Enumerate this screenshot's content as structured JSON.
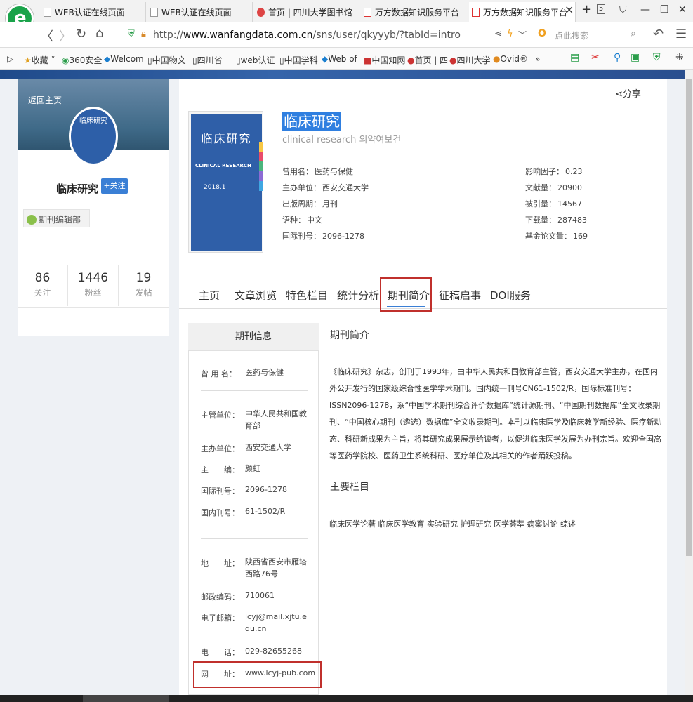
{
  "browser": {
    "tabs": [
      {
        "label": "WEB认证在线页面"
      },
      {
        "label": "WEB认证在线页面"
      },
      {
        "label": "首页 | 四川大学图书馆"
      },
      {
        "label": "万方数据知识服务平台"
      },
      {
        "label": "万方数据知识服务平台"
      }
    ],
    "tab_close": "×",
    "new_tab": "+",
    "tab_count": "5",
    "url_prefix": "http://",
    "url_host": "www.wanfangdata.com.cn",
    "url_path": "/sns/user/qkyyyb/?tabId=intro",
    "search_placeholder": "点此搜索",
    "bookmarks": [
      "收藏",
      "360安全",
      "Welcom",
      "中国物文",
      "四川省",
      "web认证",
      "中国学科",
      "Web of",
      "中国知网",
      "首页 | 四",
      "四川大学",
      "Ovid®",
      "»"
    ]
  },
  "profile": {
    "home_link": "返回主页",
    "avatar_text": "临床研究",
    "name": "临床研究",
    "follow_label": "+关注",
    "editor_tag": "期刊编辑部",
    "stats": [
      {
        "value": "86",
        "label": "关注"
      },
      {
        "value": "1446",
        "label": "粉丝"
      },
      {
        "value": "19",
        "label": "发帖"
      }
    ]
  },
  "share_label": "分享",
  "journal": {
    "cover_title": "临床研究",
    "cover_subtitle": "CLINICAL RESEARCH",
    "cover_year": "2018.1",
    "title": "临床研究",
    "subtitle": "clinical research 의약여보건",
    "left_info": [
      {
        "label": "曾用名：",
        "value": "医药与保健"
      },
      {
        "label": "主办单位：",
        "value": "西安交通大学"
      },
      {
        "label": "出版周期：",
        "value": "月刊"
      },
      {
        "label": "语种：",
        "value": "中文"
      },
      {
        "label": "国际刊号：",
        "value": "2096-1278"
      }
    ],
    "right_info": [
      {
        "label": "影响因子：",
        "value": "0.23"
      },
      {
        "label": "文献量：",
        "value": "20900"
      },
      {
        "label": "被引量：",
        "value": "14567"
      },
      {
        "label": "下载量：",
        "value": "287483"
      },
      {
        "label": "基金论文量：",
        "value": "169"
      }
    ]
  },
  "page_tabs": [
    "主页",
    "文章浏览",
    "特色栏目",
    "统计分析",
    "期刊简介",
    "征稿启事",
    "DOI服务"
  ],
  "info_box": {
    "title": "期刊信息",
    "rows": [
      {
        "label": "曾 用 名：",
        "value": "医药与保健"
      },
      {
        "label": "主管单位：",
        "value": "中华人民共和国教育部"
      },
      {
        "label": "主办单位：",
        "value": "西安交通大学"
      },
      {
        "label": "主　　编：",
        "value": "颜虹"
      },
      {
        "label": "国际刊号：",
        "value": "2096-1278"
      },
      {
        "label": "国内刊号：",
        "value": "61-1502/R"
      },
      {
        "label": "地　　址：",
        "value": "陕西省西安市雁塔西路76号"
      },
      {
        "label": "邮政编码：",
        "value": "710061"
      },
      {
        "label": "电子邮箱：",
        "value": "lcyj@mail.xjtu.edu.cn"
      },
      {
        "label": "电　　话：",
        "value": "029-82655268"
      },
      {
        "label": "网　　址：",
        "value": "www.lcyj-pub.com"
      }
    ]
  },
  "intro": {
    "title": "期刊简介",
    "text": "《临床研究》杂志，创刊于1993年，由中华人民共和国教育部主管，西安交通大学主办，在国内外公开发行的国家级综合性医学学术期刊。国内统一刊号CN61-1502/R，国际标准刊号：ISSN2096-1278，系“中国学术期刊综合评价数据库”统计源期刊、“中国期刊数据库”全文收录期刊、“中国核心期刊（遴选）数据库”全文收录期刊。本刊以临床医学及临床教学新经验、医疗新动态、科研新成果为主旨，将其研究成果展示给读者，以促进临床医学发展为办刊宗旨。欢迎全国高等医药学院校、医药卫生系统科研、医疗单位及其相关的作者踊跃投稿。"
  },
  "columns": {
    "title": "主要栏目",
    "text": "临床医学论著 临床医学教育 实验研究 护理研究 医学荟萃 病案讨论 综述"
  },
  "colors": {
    "accent": "#3a7fd5",
    "highlight_box": "#c0302c",
    "title_highlight": "#2f7fe0"
  }
}
